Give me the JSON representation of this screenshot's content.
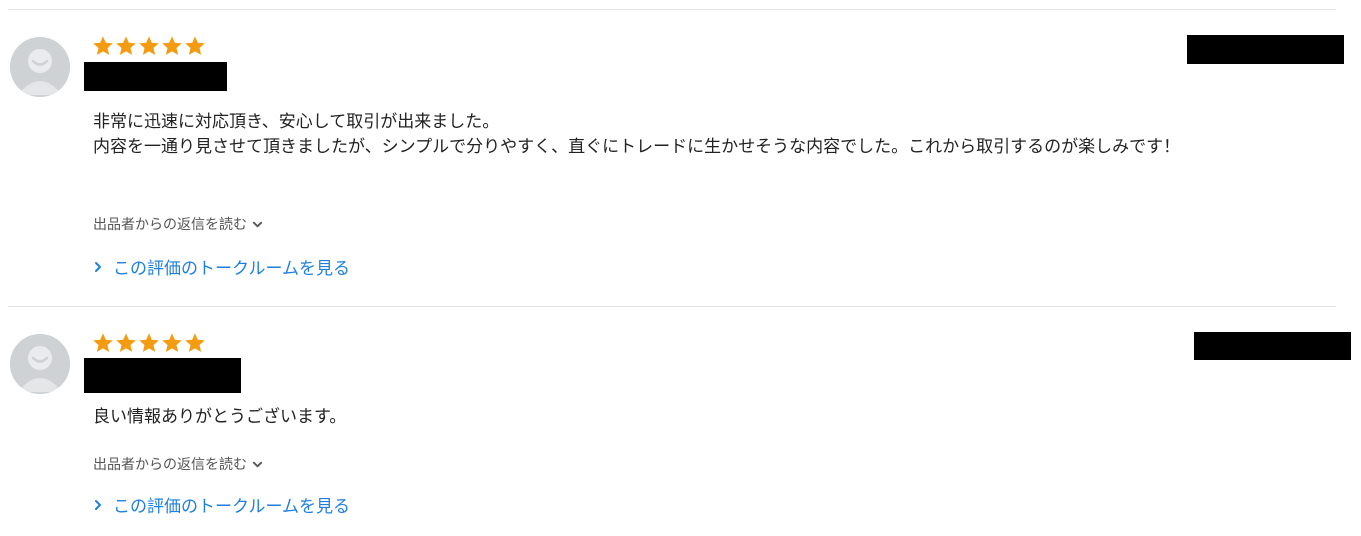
{
  "colors": {
    "star": "#f39c12",
    "link": "#1f7fe0",
    "avatar_bg": "#cfd2d4",
    "divider": "#e6e6e6"
  },
  "reviews": [
    {
      "rating": 5,
      "comment_lines": [
        "非常に迅速に対応頂き、安心して取引が出来ました。",
        "内容を一通り見させて頂きましたが、シンプルで分りやすく、直ぐにトレードに生かせそうな内容でした。これから取引するのが楽しみです！"
      ],
      "reply_toggle_label": "出品者からの返信を読む",
      "talkroom_link_label": "この評価のトークルームを見る"
    },
    {
      "rating": 5,
      "comment_lines": [
        "良い情報ありがとうございます。"
      ],
      "reply_toggle_label": "出品者からの返信を読む",
      "talkroom_link_label": "この評価のトークルームを見る"
    }
  ]
}
